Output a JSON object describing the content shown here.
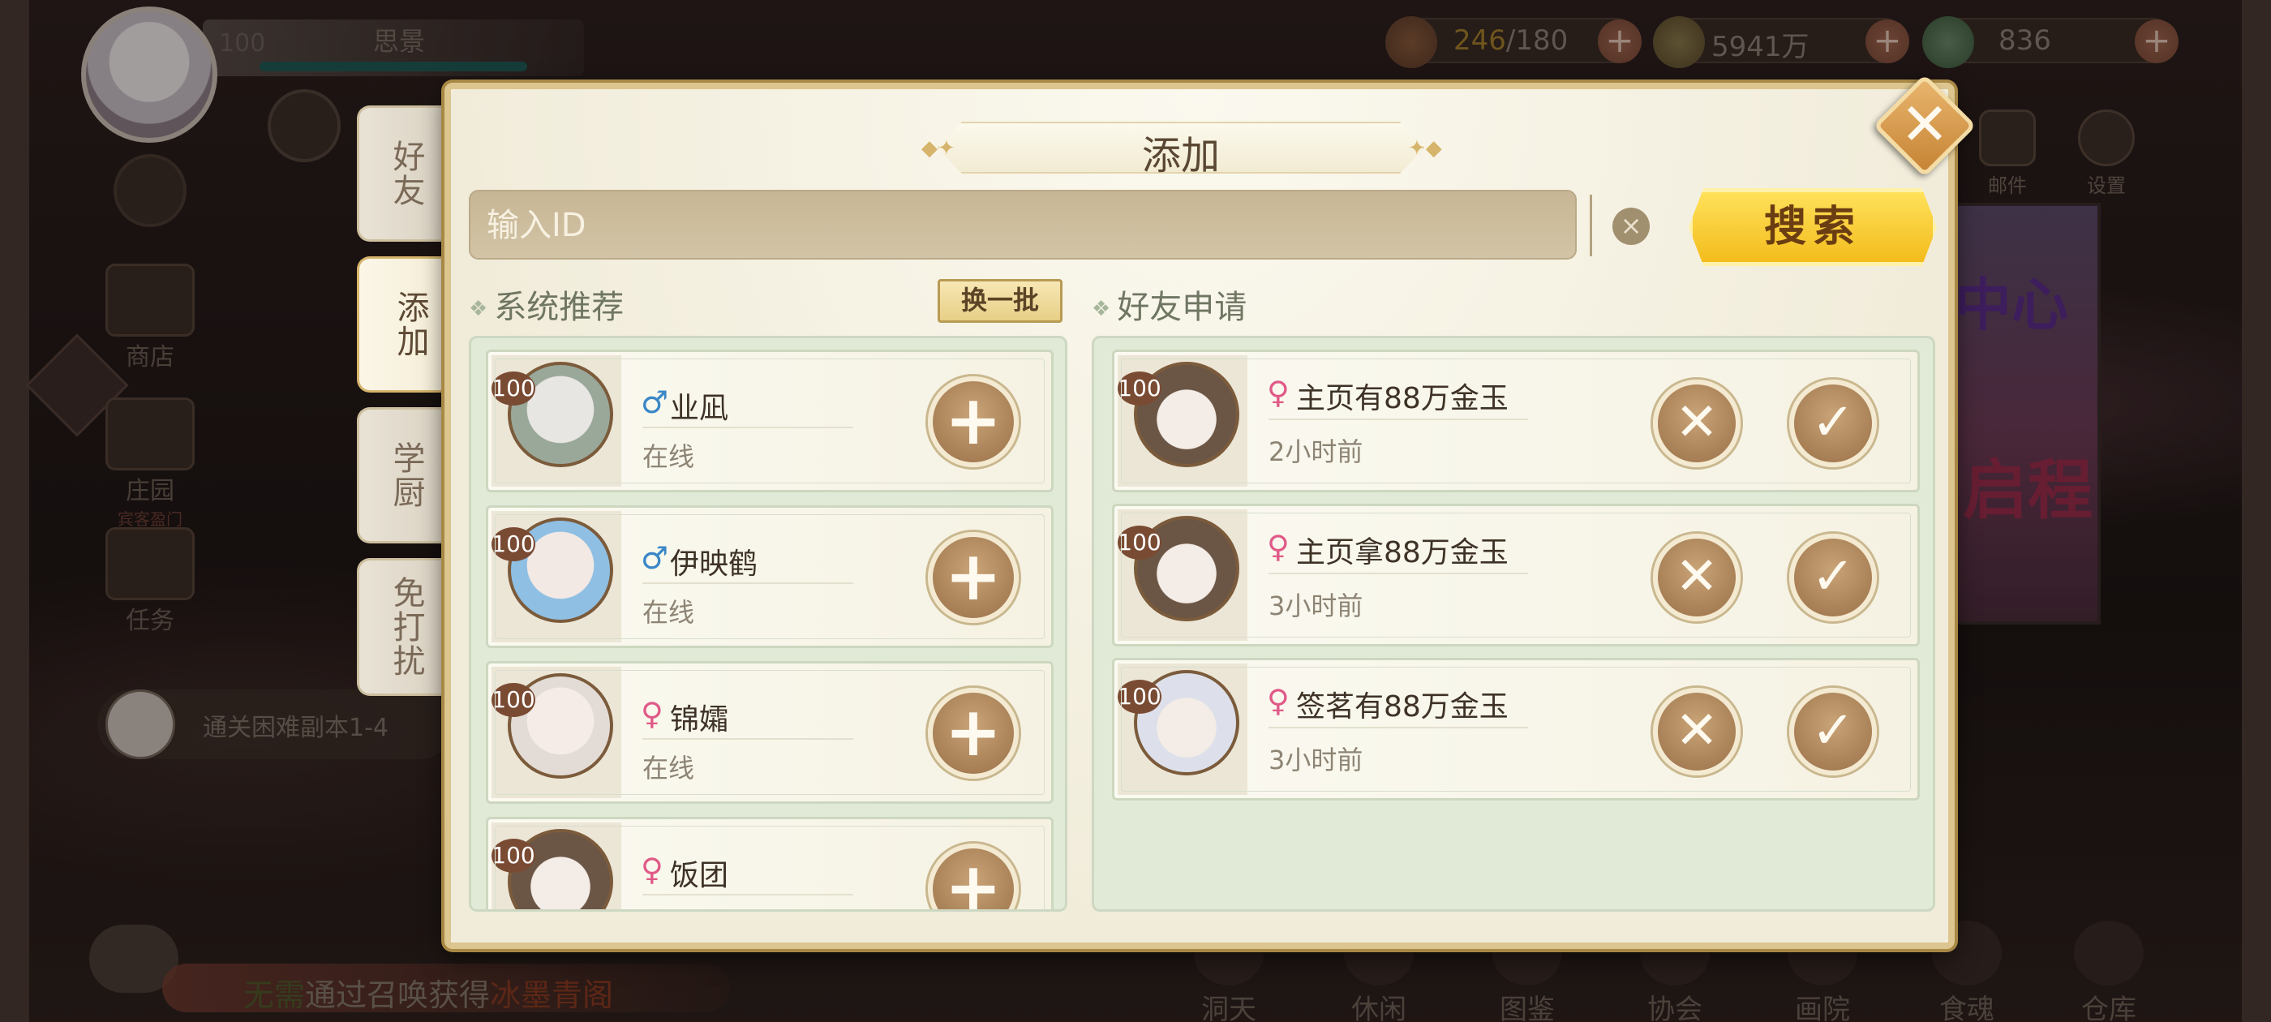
{
  "hud": {
    "player_level": "100",
    "player_name": "思景",
    "stamina_current": "246",
    "stamina_total": "/180",
    "coins": "5941万",
    "jade": "836",
    "plus": "+",
    "mail": "邮件",
    "settings": "设置"
  },
  "side_menu": {
    "shop": "商店",
    "manor": "庄园",
    "manor_sub": "宾客盈门",
    "task": "任务",
    "quest_text": "通关困难副本1-4"
  },
  "ticker": {
    "prefix": "无需",
    "text": "通过召唤获得",
    "highlight": "冰墨青阁"
  },
  "bottom_nav": [
    "洞天",
    "休闲",
    "图鉴",
    "协会",
    "画院",
    "食魂",
    "仓库"
  ],
  "poster": {
    "line1": "中心",
    "line2": "启程"
  },
  "tabs": [
    "好友",
    "添加",
    "学厨",
    "免打扰"
  ],
  "dialog": {
    "title": "添加",
    "search_placeholder": "输入ID",
    "clear_symbol": "×",
    "search_button": "搜索",
    "close_symbol": "✕"
  },
  "recommend": {
    "title": "系统推荐",
    "refresh": "换一批",
    "items": [
      {
        "level": "100",
        "gender": "♂",
        "name": "业凪",
        "status": "在线"
      },
      {
        "level": "100",
        "gender": "♂",
        "name": "伊映鹤",
        "status": "在线"
      },
      {
        "level": "100",
        "gender": "♀",
        "name": "锦孀",
        "status": "在线"
      },
      {
        "level": "100",
        "gender": "♀",
        "name": "饭团",
        "status": ""
      }
    ]
  },
  "requests": {
    "title": "好友申请",
    "items": [
      {
        "level": "100",
        "gender": "♀",
        "name": "主页有88万金玉",
        "time": "2小时前"
      },
      {
        "level": "100",
        "gender": "♀",
        "name": "主页拿88万金玉",
        "time": "3小时前"
      },
      {
        "level": "100",
        "gender": "♀",
        "name": "签茗有88万金玉",
        "time": "3小时前"
      }
    ]
  },
  "colors": {
    "accent_gold": "#f3bc1d",
    "panel_green": "#e1ead7",
    "male": "#3a87c7",
    "female": "#e05a88"
  }
}
